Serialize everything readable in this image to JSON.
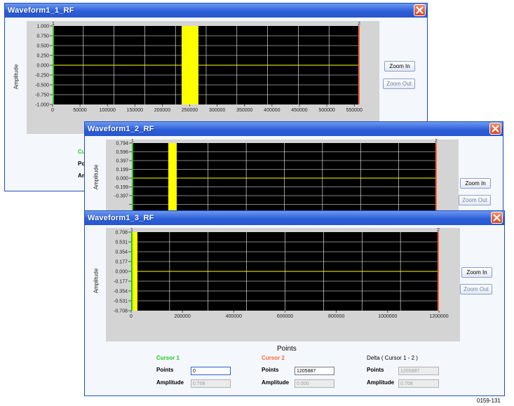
{
  "colors": {
    "cursor1": "#22cc22",
    "cursor2": "#ff6633",
    "signal": "#ffff00",
    "plot_bg": "#000000",
    "grid": "#ffffff"
  },
  "windows": [
    {
      "title": "Waveform1_1_RF",
      "y_label": "Amplitude",
      "y_ticks": [
        "1.000",
        "0.750",
        "0.500",
        "0.250",
        "0.000",
        "-0.250",
        "-0.500",
        "-0.750",
        "-1.000"
      ],
      "x_ticks": [
        "0",
        "50000",
        "100000",
        "150000",
        "200000",
        "250000",
        "300000",
        "350000",
        "400000",
        "450000",
        "500000",
        "550000"
      ],
      "cursor1_marker": "1",
      "cursor2_marker": "2",
      "zoom_in": "Zoom In",
      "zoom_out": "Zoom Out",
      "partial_labels": {
        "cursor": "Cu",
        "points": "Po",
        "amplitude": "Am"
      }
    },
    {
      "title": "Waveform1_2_RF",
      "y_label": "Amplitude",
      "y_ticks": [
        "0.794",
        "0.596",
        "0.397",
        "0.199",
        "0.000",
        "-0.199",
        "-0.397"
      ],
      "cursor1_marker": "1",
      "cursor2_marker": "2",
      "zoom_in": "Zoom In",
      "zoom_out": "Zoom Out"
    },
    {
      "title": "Waveform1_3_RF",
      "y_label": "Amplitude",
      "y_ticks": [
        "0.708",
        "0.531",
        "0.354",
        "0.177",
        "0.000",
        "-0.177",
        "-0.354",
        "-0.531",
        "-0.708"
      ],
      "x_ticks": [
        "0",
        "200000",
        "400000",
        "600000",
        "800000",
        "1000000",
        "1200000"
      ],
      "x_label": "Points",
      "cursor1_marker": "1",
      "cursor2_marker": "2",
      "zoom_in": "Zoom In",
      "zoom_out": "Zoom Out",
      "cursor1": {
        "heading": "Cursor 1",
        "points_label": "Points",
        "points_value": "0",
        "amplitude_label": "Amplitude",
        "amplitude_value": "0.708"
      },
      "cursor2": {
        "heading": "Cursor 2",
        "points_label": "Points",
        "points_value": "1205887",
        "amplitude_label": "Amplitude",
        "amplitude_value": "0.000"
      },
      "delta": {
        "heading": "Delta ( Cursor 1 - 2 )",
        "points_label": "Points",
        "points_value": "1205887",
        "amplitude_label": "Amplitude",
        "amplitude_value": "0.708"
      }
    }
  ],
  "figure_id": "0159-131"
}
